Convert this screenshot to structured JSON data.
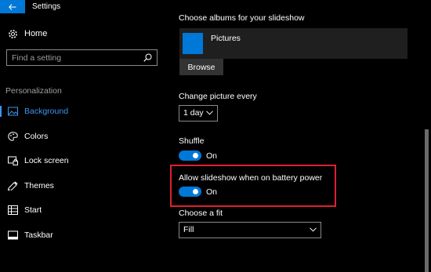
{
  "window": {
    "title": "Settings",
    "controls": {
      "minimize": "minimize-icon",
      "maximize": "maximize-icon",
      "close": "close-icon"
    }
  },
  "sidebar": {
    "home_label": "Home",
    "search_placeholder": "Find a setting",
    "section_title": "Personalization",
    "items": [
      {
        "label": "Background",
        "icon": "picture-icon",
        "active": true
      },
      {
        "label": "Colors",
        "icon": "palette-icon",
        "active": false
      },
      {
        "label": "Lock screen",
        "icon": "lock-screen-icon",
        "active": false
      },
      {
        "label": "Themes",
        "icon": "themes-icon",
        "active": false
      },
      {
        "label": "Start",
        "icon": "start-icon",
        "active": false
      },
      {
        "label": "Taskbar",
        "icon": "taskbar-icon",
        "active": false
      }
    ]
  },
  "main": {
    "albums_label": "Choose albums for your slideshow",
    "album_name": "Pictures",
    "browse_label": "Browse",
    "interval_label": "Change picture every",
    "interval_value": "1 day",
    "shuffle_label": "Shuffle",
    "shuffle_state": "On",
    "battery_label": "Allow slideshow when on battery power",
    "battery_state": "On",
    "fit_label": "Choose a fit",
    "fit_value": "Fill"
  },
  "colors": {
    "accent": "#0078d7",
    "highlight": "#e02030",
    "background": "#000000"
  }
}
